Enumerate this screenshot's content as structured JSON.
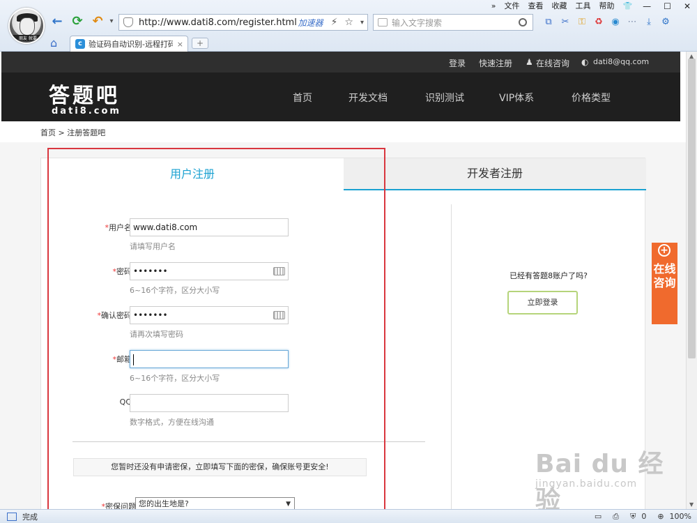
{
  "browser": {
    "avatar_text": "朋友 就要",
    "menu": [
      "文件",
      "查看",
      "收藏",
      "工具",
      "帮助"
    ],
    "menu_more": "»",
    "url": "http://www.dati8.com/register.html",
    "accelerator": "加速器",
    "search_placeholder": "输入文字搜索",
    "tab_title": "验证码自动识别-远程打码",
    "tab_close": "×",
    "new_tab": "+",
    "status_text": "完成",
    "status_count": "0",
    "zoom": "100%"
  },
  "site": {
    "top_links": {
      "login": "登录",
      "quick_register": "快速注册",
      "online_consult": "在线咨询",
      "email": "dati8@qq.com"
    },
    "logo_main": "答题吧",
    "logo_sub": "dati8.com",
    "nav": [
      "首页",
      "开发文档",
      "识别测试",
      "VIP体系",
      "价格类型"
    ],
    "breadcrumb": "首页 > 注册答题吧"
  },
  "register": {
    "tab_user": "用户注册",
    "tab_dev": "开发者注册",
    "fields": [
      {
        "required": "*",
        "label": "用户名",
        "value": "www.dati8.com",
        "hint": "请填写用户名"
      },
      {
        "required": "*",
        "label": "密码",
        "value": "•••••••",
        "hint": "6~16个字符，区分大小写"
      },
      {
        "required": "*",
        "label": "确认密码",
        "value": "•••••••",
        "hint": "请再次填写密码"
      },
      {
        "required": "*",
        "label": "邮箱",
        "value": "",
        "hint": "6~16个字符，区分大小写"
      },
      {
        "required": "",
        "label": "QQ",
        "value": "",
        "hint": "数字格式，方便在线沟通"
      }
    ],
    "notice": "您暂时还没有申请密保，立即填写下面的密保，确保账号更安全!",
    "security_question_label": "密保问题",
    "security_question_required": "*",
    "security_question_value": "您的出生地是?",
    "have_account": "已经有答题8账户了吗?",
    "login_now": "立即登录"
  },
  "side_consult": "在线咨询",
  "watermark": {
    "line1": "Bai du 经验",
    "line2": "jingyan.baidu.com"
  }
}
